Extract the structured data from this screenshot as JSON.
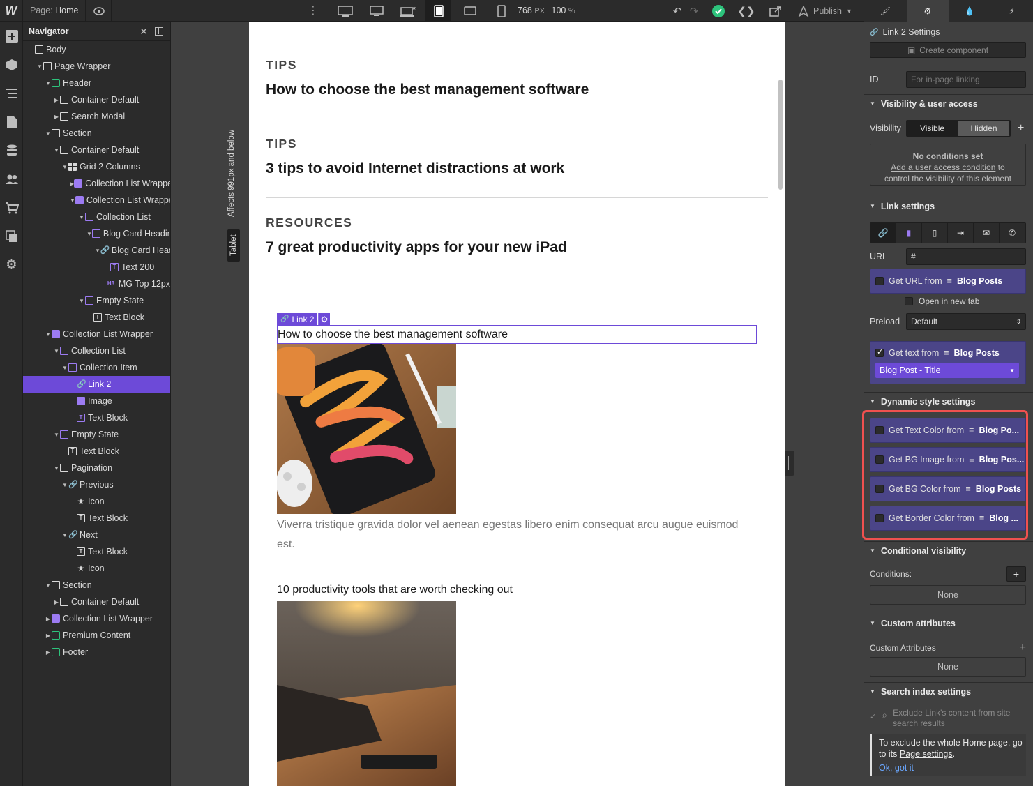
{
  "topbar": {
    "logo": "W",
    "page_prefix": "Page:",
    "page_name": "Home",
    "width_value": "768",
    "width_unit": "PX",
    "zoom_value": "100",
    "zoom_unit": "%",
    "publish_label": "Publish"
  },
  "navigator": {
    "title": "Navigator",
    "nodes": [
      {
        "label": "Body"
      },
      {
        "label": "Page Wrapper"
      },
      {
        "label": "Header"
      },
      {
        "label": "Container Default"
      },
      {
        "label": "Search Modal"
      },
      {
        "label": "Section"
      },
      {
        "label": "Container Default"
      },
      {
        "label": "Grid 2 Columns"
      },
      {
        "label": "Collection List Wrapper"
      },
      {
        "label": "Collection List Wrapper"
      },
      {
        "label": "Collection List"
      },
      {
        "label": "Blog Card Heading"
      },
      {
        "label": "Blog Card Heading"
      },
      {
        "label": "Text 200"
      },
      {
        "label": "MG Top 12px"
      },
      {
        "label": "Empty State"
      },
      {
        "label": "Text Block"
      },
      {
        "label": "Collection List Wrapper"
      },
      {
        "label": "Collection List"
      },
      {
        "label": "Collection Item"
      },
      {
        "label": "Link 2"
      },
      {
        "label": "Image"
      },
      {
        "label": "Text Block"
      },
      {
        "label": "Empty State"
      },
      {
        "label": "Text Block"
      },
      {
        "label": "Pagination"
      },
      {
        "label": "Previous"
      },
      {
        "label": "Icon"
      },
      {
        "label": "Text Block"
      },
      {
        "label": "Next"
      },
      {
        "label": "Text Block"
      },
      {
        "label": "Icon"
      },
      {
        "label": "Section"
      },
      {
        "label": "Container Default"
      },
      {
        "label": "Collection List Wrapper"
      },
      {
        "label": "Premium Content"
      },
      {
        "label": "Footer"
      }
    ],
    "h3_tag": "H3"
  },
  "canvas": {
    "affects_label": "Affects 991px and below",
    "breakpoint_label": "Tablet",
    "posts": [
      {
        "category": "TIPS",
        "title": "How to choose the best management software"
      },
      {
        "category": "TIPS",
        "title": "3 tips to avoid Internet distractions at work"
      },
      {
        "category": "RESOURCES",
        "title": "7 great productivity apps for your new iPad"
      }
    ],
    "selected_label": "Link 2",
    "link_text": "How to choose the best management software",
    "paragraph": "Viverra tristique gravida dolor vel aenean egestas libero enim consequat arcu augue euismod est.",
    "link_text_2": "10 productivity tools that are worth checking out"
  },
  "settings": {
    "title": "Link 2 Settings",
    "create_component": "Create component",
    "id_label": "ID",
    "id_placeholder": "For in-page linking",
    "visibility_section": "Visibility & user access",
    "visibility_label": "Visibility",
    "visible": "Visible",
    "hidden": "Hidden",
    "no_conditions": "No conditions set",
    "add_condition_link": "Add a user access condition",
    "add_condition_rest": " to",
    "add_condition_rest2": "control the visibility of this element",
    "link_section": "Link settings",
    "url_label": "URL",
    "url_value": "#",
    "get_url_prefix": "Get URL from",
    "collection": "Blog Posts",
    "open_new_tab": "Open in new tab",
    "preload_label": "Preload",
    "preload_value": "Default",
    "get_text_prefix": "Get text from",
    "text_field": "Blog Post - Title",
    "dynamic_section": "Dynamic style settings",
    "dyn_text_color": "Get Text Color from",
    "dyn_text_color_src": "Blog Po...",
    "dyn_bg_image": "Get BG Image from",
    "dyn_bg_image_src": "Blog Pos...",
    "dyn_bg_color": "Get BG Color from",
    "dyn_bg_color_src": "Blog Posts",
    "dyn_border": "Get Border Color from",
    "dyn_border_src": "Blog ...",
    "cond_section": "Conditional visibility",
    "conditions_label": "Conditions:",
    "none": "None",
    "custom_section": "Custom attributes",
    "custom_label": "Custom Attributes",
    "search_section": "Search index settings",
    "exclude_text": "Exclude Link's content from site search results",
    "tip_text_1": "To exclude the whole Home page, go to its ",
    "tip_link": "Page settings",
    "tip_text_2": ".",
    "ok_label": "Ok, got it"
  },
  "colors": {
    "accent": "#6d4ad8",
    "bound": "#4b4588",
    "highlight": "#f0514f",
    "green": "#2dc37c"
  }
}
